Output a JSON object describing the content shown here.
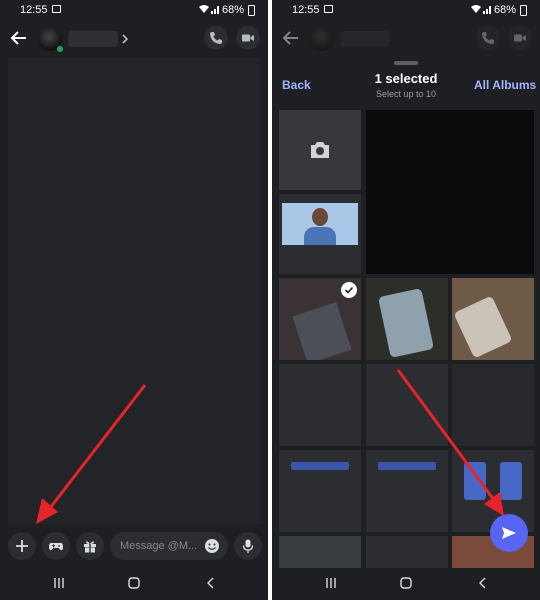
{
  "status_bar": {
    "time": "12:55",
    "battery": "68%"
  },
  "composer": {
    "placeholder": "Message @M..."
  },
  "picker": {
    "back": "Back",
    "title": "1 selected",
    "subtitle": "Select up to 10",
    "albums": "All Albums"
  },
  "colors": {
    "accent": "#5865f2",
    "annotation_arrow": "#e8232a",
    "online": "#23a55a"
  }
}
